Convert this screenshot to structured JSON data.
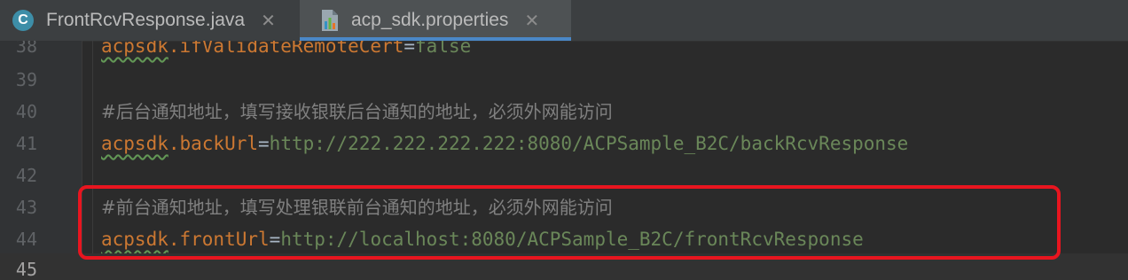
{
  "tabs": [
    {
      "label": "FrontRcvResponse.java",
      "icon": "java-class-icon",
      "active": false
    },
    {
      "label": "acp_sdk.properties",
      "icon": "properties-file-icon",
      "active": true
    }
  ],
  "close_glyph": "✕",
  "java_icon_letter": "C",
  "lines": [
    {
      "num": "38",
      "key_ns": "acpsdk",
      "key_rest": ".ifValidateRemoteCert",
      "eq": "=",
      "value": "false"
    },
    {
      "num": "39"
    },
    {
      "num": "40",
      "comment": "#后台通知地址，填写接收银联后台通知的地址，必须外网能访问"
    },
    {
      "num": "41",
      "key_ns": "acpsdk",
      "key_rest": ".backUrl",
      "eq": "=",
      "value": "http://222.222.222.222:8080/ACPSample_B2C/backRcvResponse"
    },
    {
      "num": "42"
    },
    {
      "num": "43",
      "comment": "#前台通知地址，填写处理银联前台通知的地址，必须外网能访问"
    },
    {
      "num": "44",
      "key_ns": "acpsdk",
      "key_rest": ".frontUrl",
      "eq": "=",
      "value": "http://localhost:8080/ACPSample_B2C/frontRcvResponse"
    },
    {
      "num": "45"
    }
  ],
  "colors": {
    "editor_bg": "#2b2b2b",
    "key": "#cc7832",
    "value": "#6a8759",
    "comment": "#808080",
    "highlight_border": "#e8151f",
    "active_tab_underline": "#4a88c7"
  }
}
